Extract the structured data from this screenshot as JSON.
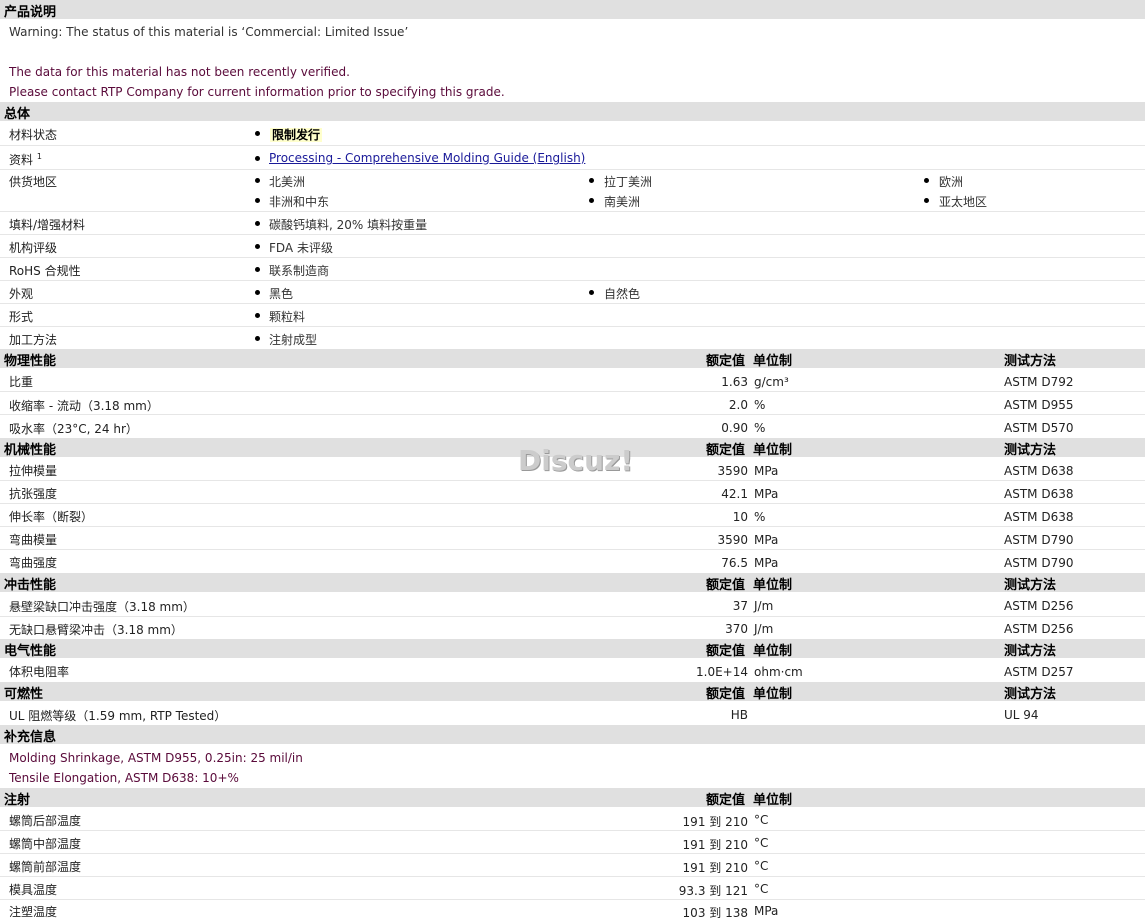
{
  "product": {
    "heading": "产品说明",
    "line1": "Warning: The status of this material is ‘Commercial: Limited Issue’",
    "line2": "The data for this material has not been recently verified.",
    "line3": "Please contact RTP Company for current information prior to specifying this grade."
  },
  "general": {
    "heading": "总体",
    "status_label": "材料状态",
    "status_value": "限制发行",
    "docs_label": "资料",
    "docs_sup": "1",
    "docs_link": "Processing - Comprehensive Molding Guide (English)",
    "region_label": "供货地区",
    "regions": [
      "北美洲",
      "拉丁美洲",
      "欧洲",
      "非洲和中东",
      "南美洲",
      "亚太地区"
    ],
    "filler_label": "填料/增强材料",
    "filler_value": "碳酸钙填料, 20% 填料按重量",
    "agency_label": "机构评级",
    "agency_value": "FDA 未评级",
    "rohs_label": "RoHS 合规性",
    "rohs_value": "联系制造商",
    "appearance_label": "外观",
    "appearance_values": [
      "黑色",
      "自然色"
    ],
    "form_label": "形式",
    "form_value": "颗粒料",
    "process_label": "加工方法",
    "process_value": "注射成型"
  },
  "cols": {
    "value": "额定值",
    "unit": "单位制",
    "method": "测试方法"
  },
  "physical": {
    "heading": "物理性能",
    "rows": [
      {
        "label": "比重",
        "value": "1.63",
        "unit": "g/cm³",
        "method": "ASTM D792"
      },
      {
        "label": "收缩率 - 流动（3.18 mm）",
        "value": "2.0",
        "unit": "%",
        "method": "ASTM D955"
      },
      {
        "label": "吸水率（23°C, 24 hr）",
        "value": "0.90",
        "unit": "%",
        "method": "ASTM D570"
      }
    ]
  },
  "mechanical": {
    "heading": "机械性能",
    "rows": [
      {
        "label": "拉伸模量",
        "value": "3590",
        "unit": "MPa",
        "method": "ASTM D638"
      },
      {
        "label": "抗张强度",
        "value": "42.1",
        "unit": "MPa",
        "method": "ASTM D638"
      },
      {
        "label": "伸长率（断裂）",
        "value": "10",
        "unit": "%",
        "method": "ASTM D638"
      },
      {
        "label": "弯曲模量",
        "value": "3590",
        "unit": "MPa",
        "method": "ASTM D790"
      },
      {
        "label": "弯曲强度",
        "value": "76.5",
        "unit": "MPa",
        "method": "ASTM D790"
      }
    ]
  },
  "impact": {
    "heading": "冲击性能",
    "rows": [
      {
        "label": "悬壁梁缺口冲击强度（3.18 mm）",
        "value": "37",
        "unit": "J/m",
        "method": "ASTM D256"
      },
      {
        "label": "无缺口悬臂梁冲击（3.18 mm）",
        "value": "370",
        "unit": "J/m",
        "method": "ASTM D256"
      }
    ]
  },
  "electrical": {
    "heading": "电气性能",
    "rows": [
      {
        "label": "体积电阻率",
        "value": "1.0E+14",
        "unit": "ohm·cm",
        "method": "ASTM D257"
      }
    ]
  },
  "flammability": {
    "heading": "可燃性",
    "rows": [
      {
        "label": "UL 阻燃等级（1.59 mm, RTP Tested）",
        "value": "HB",
        "unit": "",
        "method": "UL 94"
      }
    ]
  },
  "supplement": {
    "heading": "补充信息",
    "line1": "Molding Shrinkage, ASTM D955, 0.25in: 25 mil/in",
    "line2": "Tensile Elongation, ASTM D638: 10+%"
  },
  "injection": {
    "heading": "注射",
    "rows": [
      {
        "label": "螺筒后部温度",
        "value": "191 到  210",
        "unit": "°C"
      },
      {
        "label": "螺筒中部温度",
        "value": "191 到  210",
        "unit": "°C"
      },
      {
        "label": "螺筒前部温度",
        "value": "191 到  210",
        "unit": "°C"
      },
      {
        "label": "模具温度",
        "value": "93.3 到  121",
        "unit": "°C"
      },
      {
        "label": "注塑温度",
        "value": "103 到  138",
        "unit": "MPa"
      }
    ]
  },
  "watermark": "Discuz!"
}
